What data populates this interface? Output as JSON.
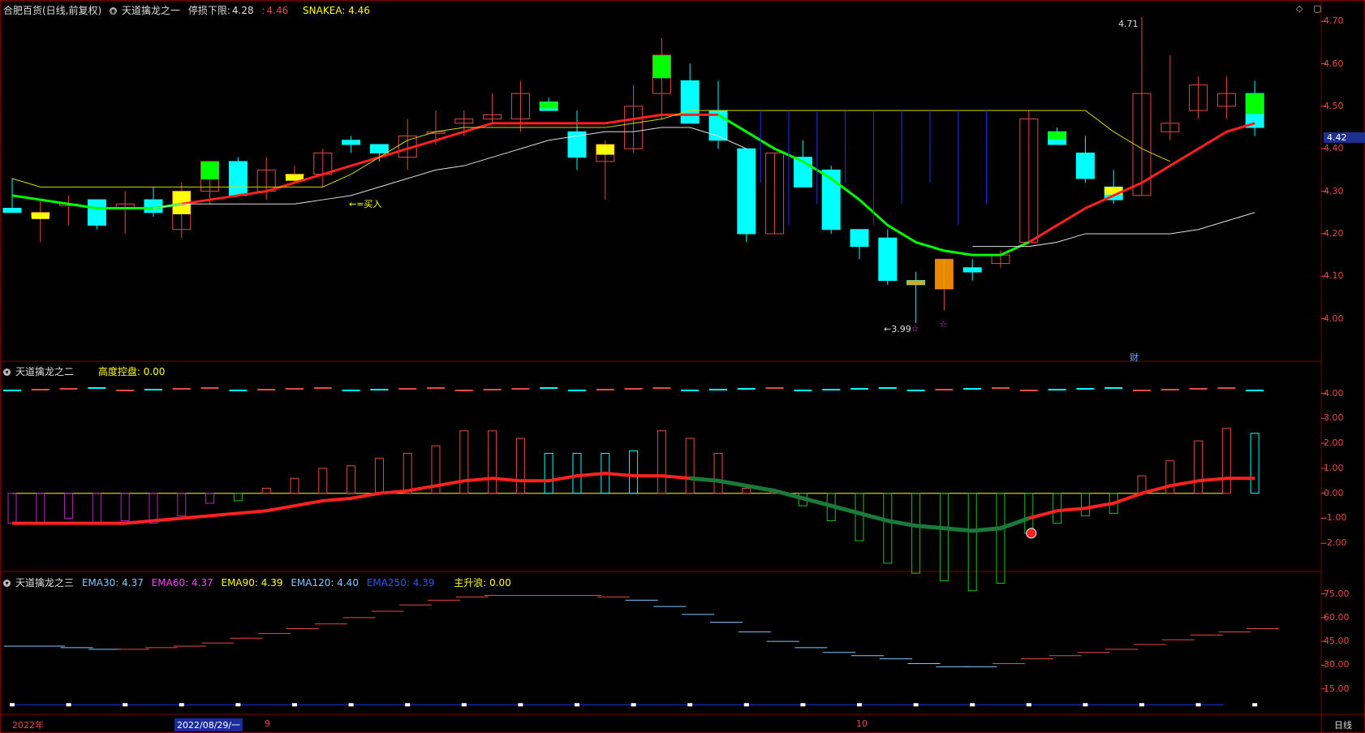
{
  "header": {
    "stock": "合肥百货(日线,前复权)",
    "indicator": "天道擒龙之一",
    "stop_label": "停损下限:",
    "stop_value": "4.28",
    "sep": ":",
    "red_value": "4.46",
    "snakea": "SNAKEA: 4.46"
  },
  "panel2": {
    "title": "天道擒龙之二",
    "control": "高度控盘: 0.00"
  },
  "panel3": {
    "title": "天道擒龙之三",
    "ema30": "EMA30: 4.37",
    "ema60": "EMA60: 4.37",
    "ema90": "EMA90: 4.39",
    "ema120": "EMA120: 4.40",
    "ema250": "EMA250: 4.39",
    "wave": "主升浪: 0.00"
  },
  "annotations": {
    "high": "4.71",
    "low": "←3.99",
    "buy": "←=买入",
    "cai": "财",
    "current_price": "4.42"
  },
  "xaxis": {
    "year": "2022年",
    "date": "2022/08/29/一",
    "m9": "9",
    "m10": "10",
    "period": "日线"
  },
  "colors": {
    "up": "#e34a4a",
    "down": "#00ffff",
    "bg": "#000000",
    "grid": "#800000"
  },
  "chart_data": {
    "type": "candlestick",
    "y_ticks_main": [
      "4.70",
      "4.60",
      "4.50",
      "4.40",
      "4.30",
      "4.20",
      "4.10",
      "4.00"
    ],
    "y_ticks_mid": [
      "4.00",
      "3.00",
      "2.00",
      "1.00",
      "0.00",
      "-1.00",
      "-2.00"
    ],
    "y_ticks_bottom": [
      "75.00",
      "60.00",
      "45.00",
      "30.00",
      "15.00"
    ],
    "candles": [
      {
        "o": 4.26,
        "h": 4.33,
        "l": 4.25,
        "c": 4.25,
        "x": 4.26
      },
      {
        "o": 4.24,
        "h": 4.28,
        "l": 4.18,
        "c": 4.25
      },
      {
        "o": 4.27,
        "h": 4.29,
        "l": 4.22,
        "c": 4.27
      },
      {
        "o": 4.28,
        "h": 4.28,
        "l": 4.21,
        "c": 4.22
      },
      {
        "o": 4.26,
        "h": 4.3,
        "l": 4.2,
        "c": 4.27
      },
      {
        "o": 4.28,
        "h": 4.31,
        "l": 4.24,
        "c": 4.25
      },
      {
        "o": 4.21,
        "h": 4.32,
        "l": 4.19,
        "c": 4.3
      },
      {
        "o": 4.3,
        "h": 4.37,
        "l": 4.27,
        "c": 4.37
      },
      {
        "o": 4.37,
        "h": 4.38,
        "l": 4.29,
        "c": 4.29
      },
      {
        "o": 4.3,
        "h": 4.38,
        "l": 4.28,
        "c": 4.35
      },
      {
        "o": 4.34,
        "h": 4.36,
        "l": 4.32,
        "c": 4.34
      },
      {
        "o": 4.34,
        "h": 4.4,
        "l": 4.31,
        "c": 4.39
      },
      {
        "o": 4.42,
        "h": 4.43,
        "l": 4.39,
        "c": 4.41
      },
      {
        "o": 4.41,
        "h": 4.41,
        "l": 4.37,
        "c": 4.39
      },
      {
        "o": 4.38,
        "h": 4.47,
        "l": 4.35,
        "c": 4.43
      },
      {
        "o": 4.44,
        "h": 4.49,
        "l": 4.41,
        "c": 4.44
      },
      {
        "o": 4.46,
        "h": 4.49,
        "l": 4.43,
        "c": 4.47
      },
      {
        "o": 4.47,
        "h": 4.53,
        "l": 4.46,
        "c": 4.48
      },
      {
        "o": 4.47,
        "h": 4.56,
        "l": 4.44,
        "c": 4.53
      },
      {
        "o": 4.51,
        "h": 4.52,
        "l": 4.49,
        "c": 4.49
      },
      {
        "o": 4.44,
        "h": 4.49,
        "l": 4.35,
        "c": 4.38
      },
      {
        "o": 4.37,
        "h": 4.42,
        "l": 4.28,
        "c": 4.41
      },
      {
        "o": 4.4,
        "h": 4.55,
        "l": 4.39,
        "c": 4.5
      },
      {
        "o": 4.53,
        "h": 4.66,
        "l": 4.47,
        "c": 4.62
      },
      {
        "o": 4.56,
        "h": 4.6,
        "l": 4.46,
        "c": 4.46
      },
      {
        "o": 4.49,
        "h": 4.56,
        "l": 4.4,
        "c": 4.42
      },
      {
        "o": 4.4,
        "h": 4.4,
        "l": 4.18,
        "c": 4.2
      },
      {
        "o": 4.2,
        "h": 4.39,
        "l": 4.2,
        "c": 4.39
      },
      {
        "o": 4.38,
        "h": 4.42,
        "l": 4.31,
        "c": 4.31
      },
      {
        "o": 4.35,
        "h": 4.36,
        "l": 4.2,
        "c": 4.21
      },
      {
        "o": 4.21,
        "h": 4.21,
        "l": 4.14,
        "c": 4.17
      },
      {
        "o": 4.19,
        "h": 4.21,
        "l": 4.08,
        "c": 4.09
      },
      {
        "o": 4.09,
        "h": 4.11,
        "l": 3.99,
        "c": 4.08
      },
      {
        "o": 4.07,
        "h": 4.14,
        "l": 4.02,
        "c": 4.14
      },
      {
        "o": 4.12,
        "h": 4.14,
        "l": 4.09,
        "c": 4.11
      },
      {
        "o": 4.13,
        "h": 4.16,
        "l": 4.12,
        "c": 4.15
      },
      {
        "o": 4.18,
        "h": 4.49,
        "l": 4.18,
        "c": 4.47
      },
      {
        "o": 4.44,
        "h": 4.45,
        "l": 4.41,
        "c": 4.41
      },
      {
        "o": 4.39,
        "h": 4.43,
        "l": 4.32,
        "c": 4.33
      },
      {
        "o": 4.31,
        "h": 4.35,
        "l": 4.27,
        "c": 4.28
      },
      {
        "o": 4.29,
        "h": 4.71,
        "l": 4.29,
        "c": 4.53
      },
      {
        "o": 4.44,
        "h": 4.62,
        "l": 4.42,
        "c": 4.46
      },
      {
        "o": 4.49,
        "h": 4.57,
        "l": 4.47,
        "c": 4.55
      },
      {
        "o": 4.5,
        "h": 4.57,
        "l": 4.47,
        "c": 4.53
      },
      {
        "o": 4.53,
        "h": 4.56,
        "l": 4.43,
        "c": 4.45
      }
    ]
  }
}
